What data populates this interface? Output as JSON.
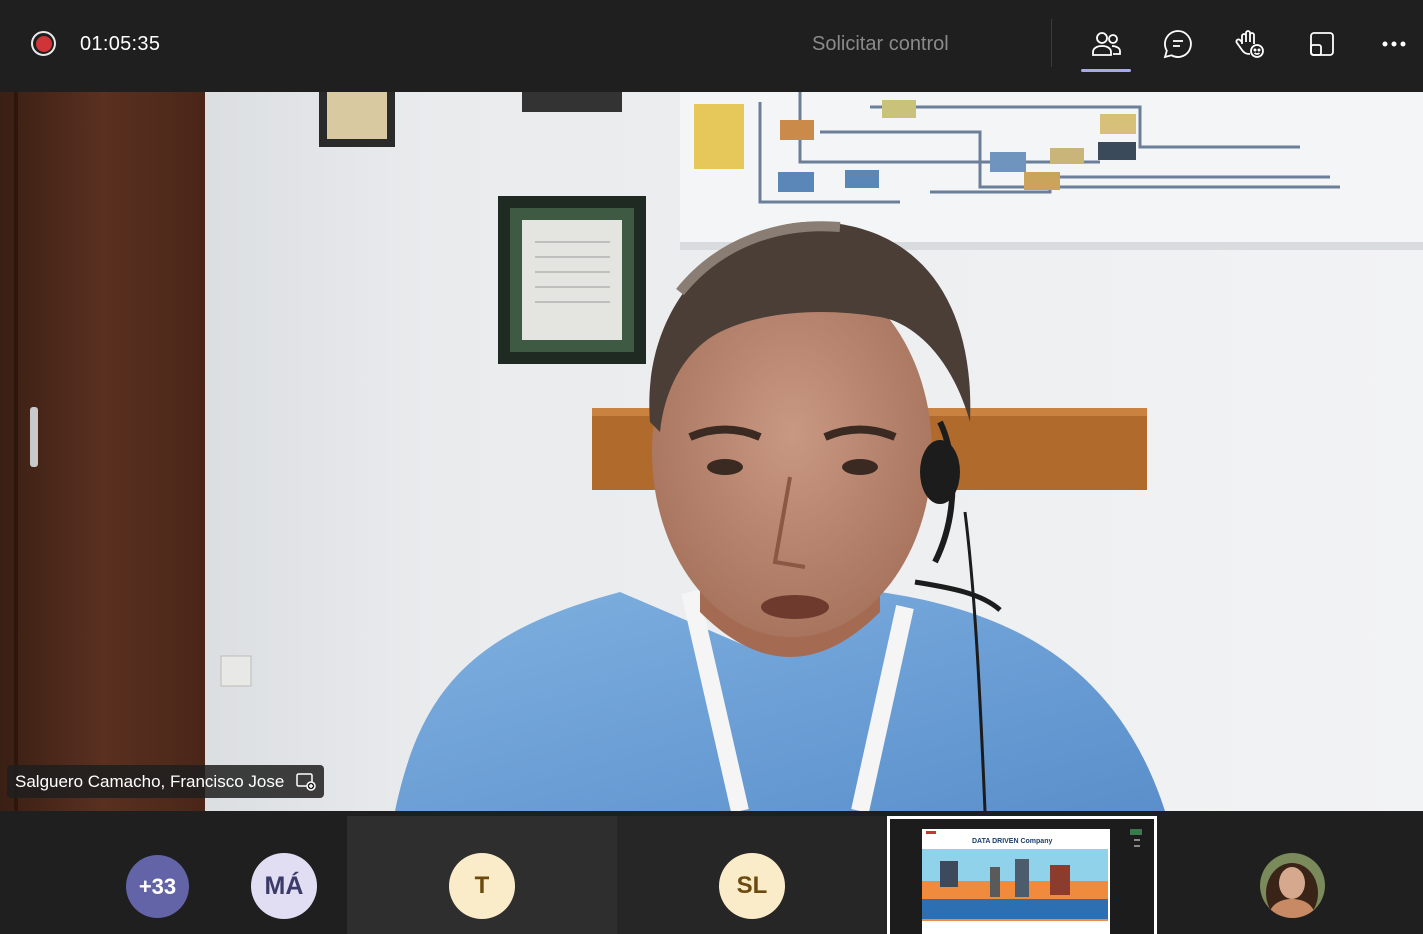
{
  "topbar": {
    "timer": "01:05:35",
    "request_control_label": "Solicitar control",
    "buttons": [
      {
        "name": "people-button",
        "icon": "people-icon",
        "active": true
      },
      {
        "name": "chat-button",
        "icon": "chat-icon"
      },
      {
        "name": "react-button",
        "icon": "raise-hand-icon"
      },
      {
        "name": "view-button",
        "icon": "view-icon"
      },
      {
        "name": "more-button",
        "icon": "more-icon"
      }
    ]
  },
  "main_video": {
    "participant_name": "Salguero Camacho, Francisco Jose"
  },
  "participants_strip": {
    "overflow_count": "+33",
    "tiles": [
      {
        "initials": "MÁ"
      },
      {
        "initials": "T"
      },
      {
        "initials": "SL"
      }
    ],
    "share_tile": {
      "slide_title": "DATA DRIVEN Company"
    }
  },
  "colors": {
    "background": "#1f1f1f",
    "recording": "#d13438",
    "accent": "#6264a7",
    "active_indicator": "#a7a9ee"
  }
}
